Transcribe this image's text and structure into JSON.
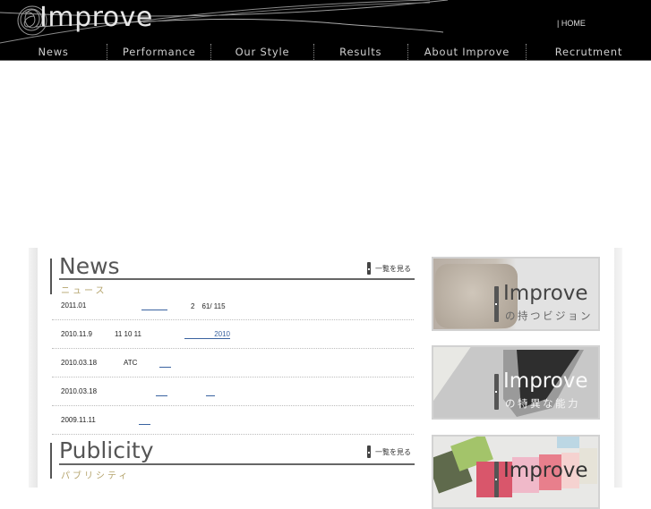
{
  "header": {
    "logo_text": "Improve",
    "home_link": "| HOME",
    "nav": [
      {
        "label": "News"
      },
      {
        "label": "Performance"
      },
      {
        "label": "Our Style"
      },
      {
        "label": "Results"
      },
      {
        "label": "About Improve"
      },
      {
        "label": "Recrutment"
      }
    ]
  },
  "news": {
    "title": "News",
    "subtitle": "ニュース",
    "view_all_label": "一覧を見る",
    "items": [
      {
        "date": "2011.01",
        "text": "",
        "link_text": "",
        "after_text": "2　61/ 115"
      },
      {
        "date": "2010.11.9",
        "text": "11 10 11",
        "link_text": "2010",
        "after_text": ""
      },
      {
        "date": "2010.03.18",
        "text": "ATC",
        "link_text": "",
        "after_text": ""
      },
      {
        "date": "2010.03.18",
        "text": "",
        "link_text": "",
        "after_text": ""
      },
      {
        "date": "2009.11.11",
        "text": "",
        "link_text": "",
        "after_text": ""
      }
    ]
  },
  "publicity": {
    "title": "Publicity",
    "subtitle": "パブリシティ",
    "view_all_label": "一覧を見る"
  },
  "banners": [
    {
      "title": "Improve",
      "subtitle": "の持つビジョン"
    },
    {
      "title": "Improve",
      "subtitle": "の特異な能力"
    },
    {
      "title": "Improve",
      "subtitle": ""
    }
  ]
}
